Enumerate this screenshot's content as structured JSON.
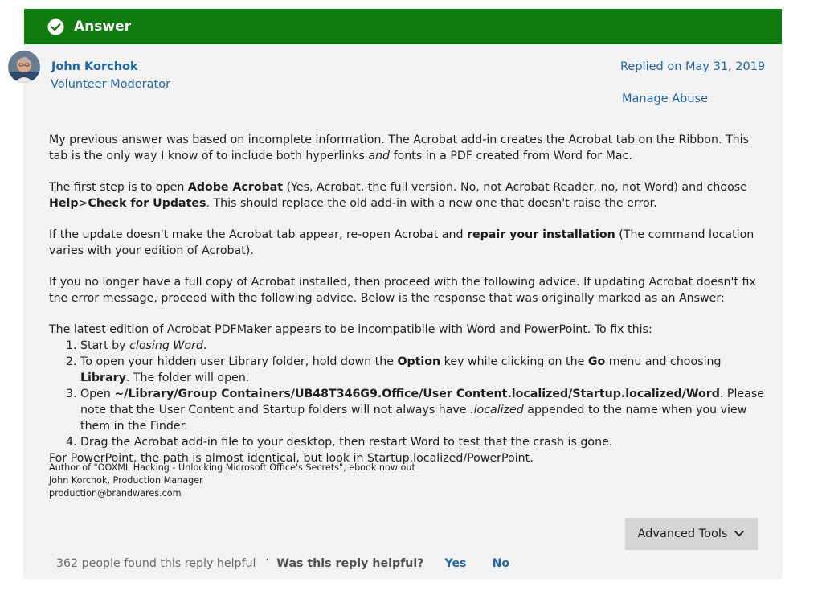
{
  "answer_bar": {
    "label": "Answer",
    "color": "#107c10"
  },
  "author": {
    "name": "John Korchok",
    "role": "Volunteer Moderator",
    "avatar_icon": "user-avatar"
  },
  "meta": {
    "replied": "Replied on May 31, 2019",
    "manage_abuse": "Manage Abuse"
  },
  "post": {
    "p1_a": "My previous answer was based on incomplete information. The Acrobat add-in creates the Acrobat tab on the Ribbon. This tab is the only way I know of to include both hyperlinks ",
    "p1_em": "and",
    "p1_b": " fonts in a PDF created from Word for Mac.",
    "p2_a": "The first step is to open ",
    "p2_b1": "Adobe Acrobat",
    "p2_c": " (Yes, Acrobat, the full version. No, not Acrobat Reader, no, not Word) and choose ",
    "p2_b2": "Help",
    "p2_gt": ">",
    "p2_b3": "Check for Updates",
    "p2_d": ". This should replace the old add-in with a new one that doesn't raise the error.",
    "p3_a": "If the update doesn't make the Acrobat tab appear, re-open Acrobat and ",
    "p3_b": "repair your installation",
    "p3_c": " (The command location varies with your edition of Acrobat).",
    "p4": "If you no longer have a full copy of Acrobat installed, then proceed with the following advice. If updating Acrobat doesn't fix the error message, proceed with the following advice. Below is the response that was originally marked as an Answer:",
    "p5": "The latest edition of Acrobat PDFMaker appears to be incompatibile with Word and PowerPoint. To fix this:",
    "step1_a": "Start by ",
    "step1_em": "closing Word",
    "step1_b": ".",
    "step2_a": "To open your hidden user Library folder, hold down the ",
    "step2_b1": "Option",
    "step2_c": " key while clicking on the ",
    "step2_b2": "Go",
    "step2_d": " menu and choosing ",
    "step2_b3": "Library",
    "step2_e": ". The folder will open.",
    "step3_a": "Open ",
    "step3_b": "~/Library/Group Containers/UB48T346G9.Office/User Content.localized/Startup.localized/Word",
    "step3_c": ". Please note that the User Content and Startup folders will not always have ",
    "step3_em": ".localized",
    "step3_d": " appended to the name when you view them in the Finder.",
    "step4": "Drag the Acrobat add-in file to your desktop, then restart Word to test that the crash is gone.",
    "p6": "For PowerPoint, the path is almost identical, but look in Startup.localized/PowerPoint."
  },
  "signature": {
    "line1": "Author of \"OOXML Hacking - Unlocking Microsoft Office's Secrets\", ebook now out",
    "line2": "John Korchok, Production Manager",
    "line3": "production@brandwares.com"
  },
  "tools": {
    "advanced_label": "Advanced Tools"
  },
  "footer": {
    "helpful_count": "362 people found this reply helpful",
    "separator": "·",
    "question": "Was this reply helpful?",
    "yes": "Yes",
    "no": "No"
  }
}
